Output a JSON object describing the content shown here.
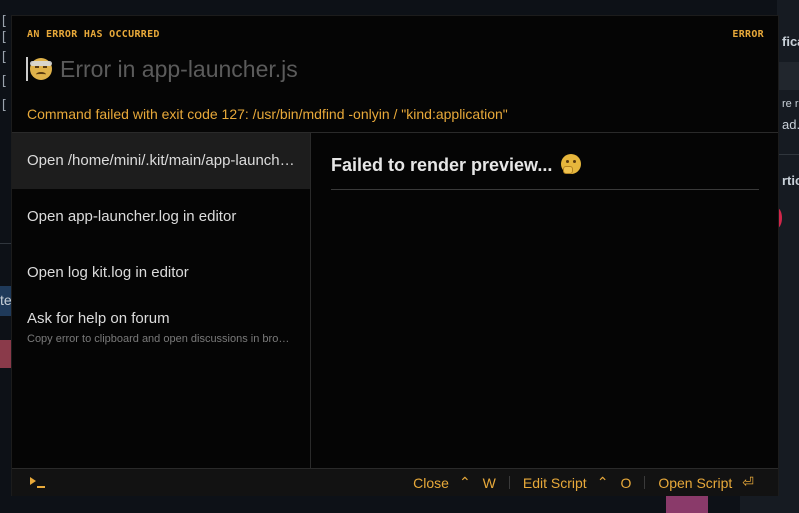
{
  "header": {
    "label": "AN ERROR HAS OCCURRED",
    "badge": "ERROR",
    "title": "Error in app-launcher.js",
    "message": "Command failed with exit code 127: /usr/bin/mdfind -onlyin / \"kind:application\""
  },
  "choices": [
    {
      "label": "Open /home/mini/.kit/main/app-launcher.js",
      "description": "",
      "selected": true
    },
    {
      "label": "Open app-launcher.log in editor",
      "description": ""
    },
    {
      "label": "Open log kit.log in editor",
      "description": ""
    },
    {
      "label": "Ask for help on forum",
      "description": "Copy error to clipboard and open discussions in browser"
    }
  ],
  "preview": {
    "text": "Failed to render preview...",
    "emoji": "thinking-face-icon"
  },
  "footer": {
    "actions": [
      {
        "label": "Close",
        "key1": "⌃",
        "key2": "W"
      },
      {
        "label": "Edit Script",
        "key1": "⌃",
        "key2": "O"
      },
      {
        "label": "Open Script",
        "key1": "⏎",
        "key2": ""
      }
    ]
  },
  "background": {
    "right_fragments": [
      "fica",
      "re r",
      "ad.",
      "rtic"
    ],
    "left_fragment": "te"
  },
  "colors": {
    "accent": "#e8a93a",
    "window_bg": "#050505",
    "selected_bg": "#1d1d1d",
    "text": "#dcdcdc",
    "muted": "#7a7a7a"
  }
}
